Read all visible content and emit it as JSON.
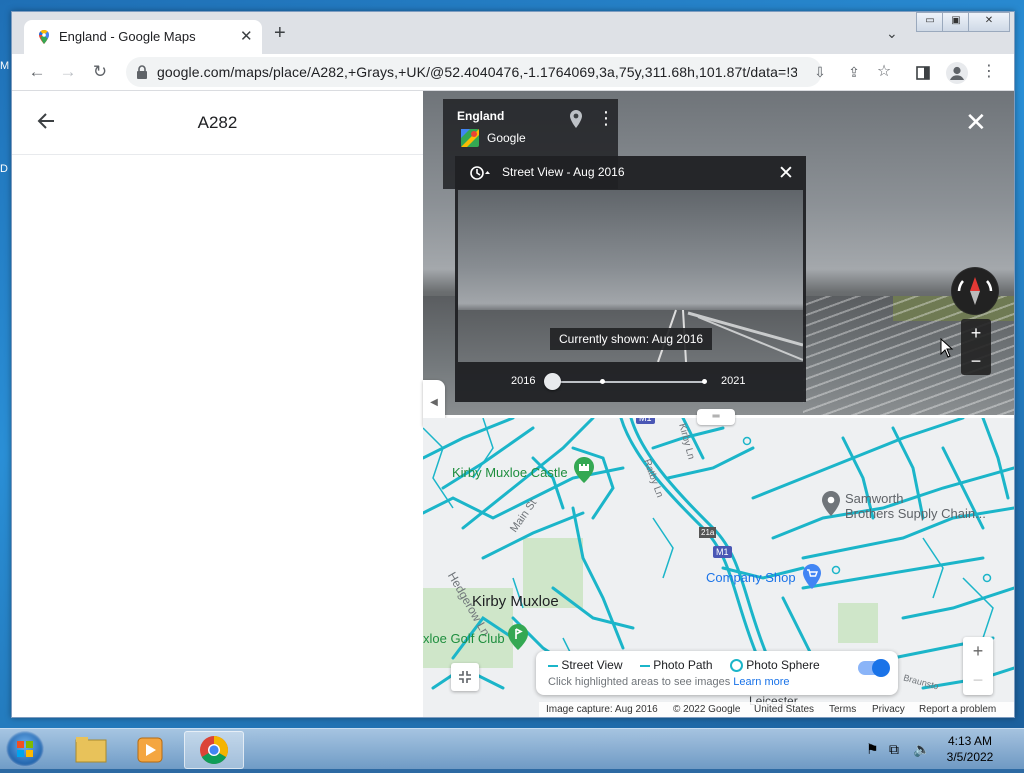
{
  "desktop": {
    "edge_letters": [
      "M",
      "D"
    ]
  },
  "browser": {
    "tab_title": "England - Google Maps",
    "url": "google.com/maps/place/A282,+Grays,+UK/@52.4040476,-1.1764069,3a,75y,311.68h,101.87t/data=!3...",
    "window_controls": {
      "minimize": "▭",
      "maximize": "▣",
      "close": "✕"
    }
  },
  "side_panel": {
    "title": "A282"
  },
  "street_view": {
    "location": "England",
    "provider": "Google"
  },
  "time_machine": {
    "header": "Street View - Aug 2016",
    "tooltip": "Currently shown: Aug 2016",
    "year_start": "2016",
    "year_end": "2021",
    "selected_fraction": 0.0
  },
  "map": {
    "labels": {
      "castle": "Kirby Muxloe Castle",
      "town": "Kirby Muxloe",
      "golf": "xloe Golf Club",
      "shop": "Company Shop",
      "supply1": "Samworth",
      "supply2": "Brothers Supply Chain...",
      "road_main": "Main St",
      "road_hedge": "Hedgerow Ln",
      "road_kirby": "Kirby Ln",
      "road_ratby": "Ratby Ln",
      "m1_a": "M1",
      "m1_b": "M1",
      "junction": "21a",
      "braunstone": "Braunsto",
      "leicester": "Leicester"
    },
    "legend": {
      "street_view": "Street View",
      "photo_path": "Photo Path",
      "photo_sphere": "Photo Sphere",
      "hint": "Click highlighted areas to see images",
      "learn_more": "Learn more"
    },
    "footer": {
      "capture": "Image capture: Aug 2016",
      "copyright": "© 2022 Google",
      "country": "United States",
      "terms": "Terms",
      "privacy": "Privacy",
      "report": "Report a problem"
    }
  },
  "taskbar": {
    "time": "4:13 AM",
    "date": "3/5/2022"
  },
  "colors": {
    "coverage": "#1bb5c9",
    "accent": "#1a73e8"
  }
}
